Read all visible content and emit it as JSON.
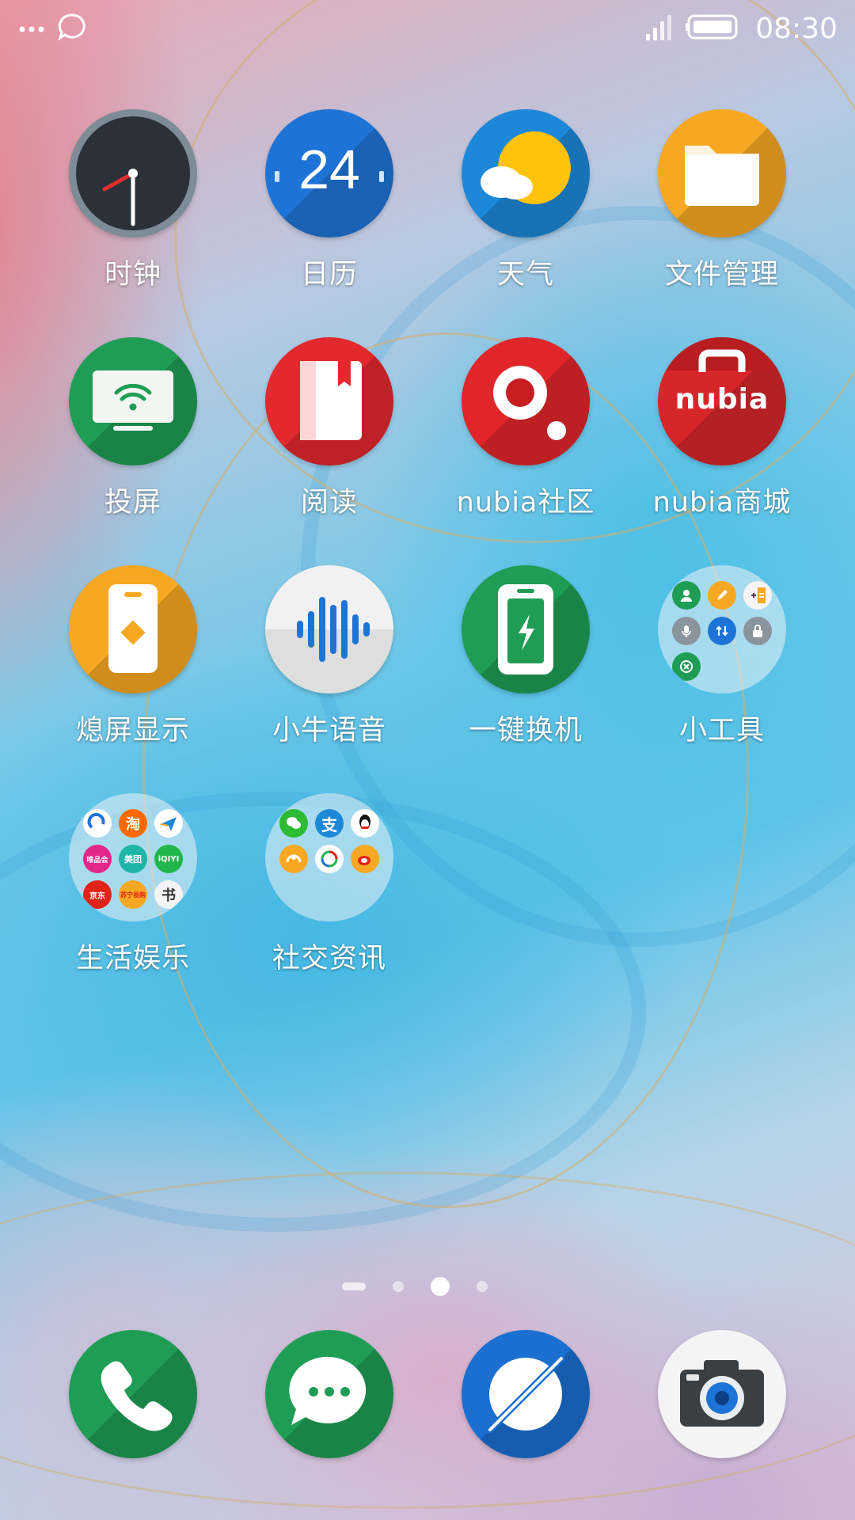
{
  "status_bar": {
    "time": "08:30",
    "left_icons": [
      "more-dots-icon",
      "message-bubble-icon"
    ],
    "right_icons": [
      "signal-icon",
      "battery-icon"
    ]
  },
  "apps": [
    {
      "label": "时钟",
      "icon": "clock-icon",
      "color": "#2a3139"
    },
    {
      "label": "日历",
      "icon": "calendar-icon",
      "color": "#1e74d6",
      "date": "24"
    },
    {
      "label": "天气",
      "icon": "weather-icon",
      "color": "#1e88d8"
    },
    {
      "label": "文件管理",
      "icon": "folder-icon",
      "color": "#f7a823"
    },
    {
      "label": "投屏",
      "icon": "screen-cast-icon",
      "color": "#1f9d55"
    },
    {
      "label": "阅读",
      "icon": "book-icon",
      "color": "#e2292d"
    },
    {
      "label": "nubia社区",
      "icon": "nubia-community-icon",
      "color": "#e0262a"
    },
    {
      "label": "nubia商城",
      "icon": "nubia-store-icon",
      "color": "#d7262a",
      "logo_text": "nubia"
    },
    {
      "label": "熄屏显示",
      "icon": "always-on-display-icon",
      "color": "#f7a823"
    },
    {
      "label": "小牛语音",
      "icon": "voice-wave-icon",
      "color": "#f1f1f1"
    },
    {
      "label": "一键换机",
      "icon": "phone-switch-icon",
      "color": "#1f9d55"
    },
    {
      "label": "小工具",
      "icon": "tools-folder-icon",
      "color": "#dfe8ee"
    },
    {
      "label": "生活娱乐",
      "icon": "life-entertainment-folder-icon",
      "color": "#e9eef2"
    },
    {
      "label": "社交资讯",
      "icon": "social-news-folder-icon",
      "color": "#e9eef2"
    }
  ],
  "folder_badges": {
    "taobao": "淘",
    "vip": "唯品会",
    "meituan": "美团",
    "iqiyi": "iQIYI",
    "jd": "京东",
    "suning": "苏宁易购",
    "book": "书",
    "alipay": "支"
  },
  "dock": [
    {
      "icon": "phone-icon",
      "color": "#1f9d55"
    },
    {
      "icon": "messages-icon",
      "color": "#1f9d55"
    },
    {
      "icon": "browser-icon",
      "color": "#1a6fd0"
    },
    {
      "icon": "camera-icon",
      "color": "#f4f4f4"
    }
  ],
  "page_indicator": {
    "pages": 3,
    "active": 2
  }
}
